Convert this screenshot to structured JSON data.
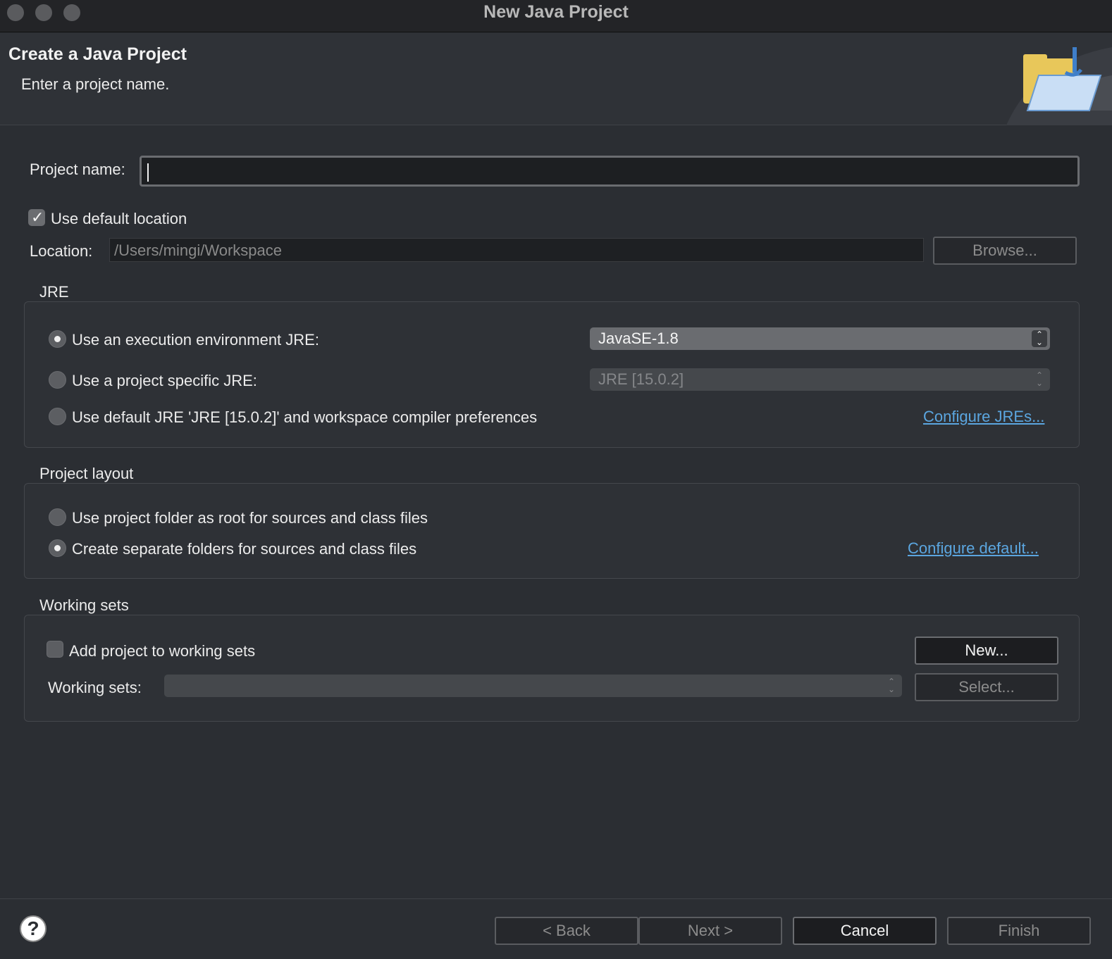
{
  "window": {
    "title": "New Java Project"
  },
  "banner": {
    "title": "Create a Java Project",
    "subtitle": "Enter a project name."
  },
  "project": {
    "name_label": "Project name:",
    "name_value": ""
  },
  "location": {
    "use_default_label": "Use default location",
    "use_default_checked": true,
    "label": "Location:",
    "value": "/Users/mingi/Workspace",
    "browse_label": "Browse..."
  },
  "jre": {
    "title": "JRE",
    "option_exec_env": "Use an execution environment JRE:",
    "option_project_specific": "Use a project specific JRE:",
    "option_default": "Use default JRE 'JRE [15.0.2]' and workspace compiler preferences",
    "exec_env_selected": "JavaSE-1.8",
    "project_specific_selected": "JRE [15.0.2]",
    "configure_link": "Configure JREs..."
  },
  "layout": {
    "title": "Project layout",
    "option_root": "Use project folder as root for sources and class files",
    "option_separate": "Create separate folders for sources and class files",
    "configure_link": "Configure default..."
  },
  "working_sets": {
    "title": "Working sets",
    "add_label": "Add project to working sets",
    "add_checked": false,
    "sets_label": "Working sets:",
    "sets_value": "",
    "new_label": "New...",
    "select_label": "Select..."
  },
  "footer": {
    "help_glyph": "?",
    "back_label": "< Back",
    "next_label": "Next >",
    "cancel_label": "Cancel",
    "finish_label": "Finish"
  },
  "glyphs": {
    "checkmark": "✓",
    "updown": "⌃⌄"
  },
  "colors": {
    "link": "#5ba6e0",
    "background": "#2b2e33"
  }
}
